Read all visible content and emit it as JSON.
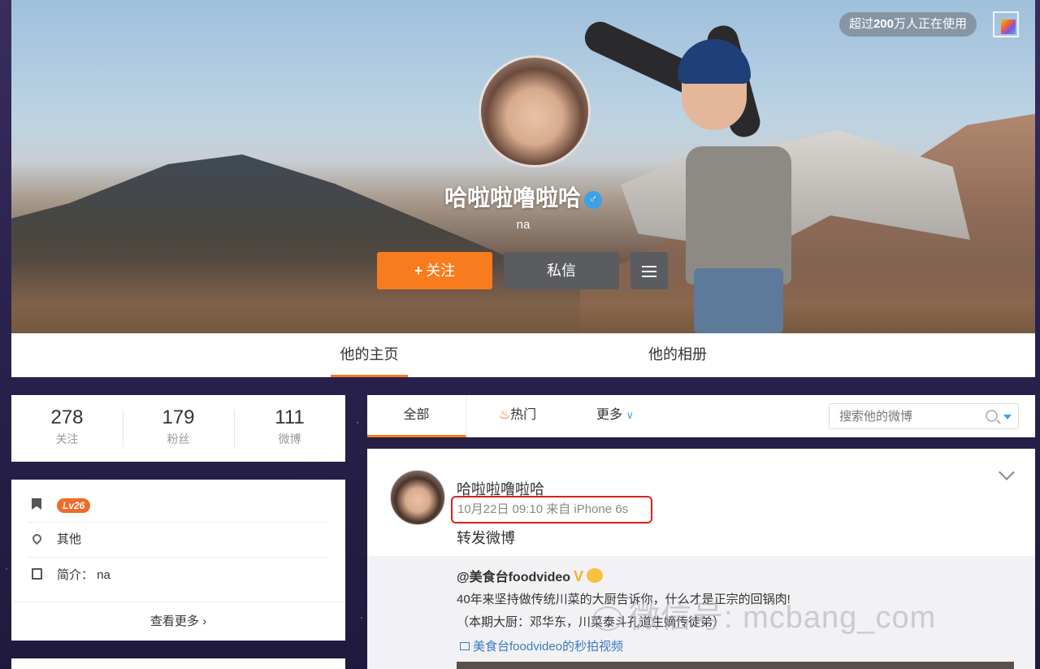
{
  "cover": {
    "user_count": {
      "prefix": "超过",
      "number": "200",
      "suffix": "万人正在使用"
    },
    "profile": {
      "name": "哈啦啦噜啦哈",
      "gender_symbol": "♂",
      "description": "na"
    },
    "buttons": {
      "follow_plus": "+",
      "follow_label": "关注",
      "message_label": "私信"
    }
  },
  "tabs": {
    "home": "他的主页",
    "album": "他的相册"
  },
  "stats": [
    {
      "value": "278",
      "label": "关注"
    },
    {
      "value": "179",
      "label": "粉丝"
    },
    {
      "value": "111",
      "label": "微博"
    }
  ],
  "info": {
    "level_badge": "Lv26",
    "location": "其他",
    "bio_label": "简介：",
    "bio_value": "na",
    "more_label": "查看更多",
    "more_arrow": "›"
  },
  "feed_tabs": {
    "all": "全部",
    "hot_icon": "♨",
    "hot": "热门",
    "more": "更多",
    "more_chevron": "∨",
    "search_placeholder": "搜索他的微博"
  },
  "post": {
    "author": "哈啦啦噜啦哈",
    "meta": "10月22日 09:10 来自 iPhone 6s",
    "text": "转发微博",
    "repost": {
      "author": "@美食台foodvideo",
      "v_badge": "V",
      "line1": "40年来坚持做传统川菜的大厨告诉你，什么才是正宗的回锅肉!",
      "line2": "（本期大厨：邓华东，川菜泰斗孔道生嫡传徒弟）",
      "video_link": "美食台foodvideo的秒拍视频"
    }
  },
  "watermark": "微信号: mcbang_com",
  "colors": {
    "accent": "#f87c1d",
    "highlight_border": "#d9221c",
    "link": "#3a7bbf",
    "level_badge": "#f06a2a"
  }
}
